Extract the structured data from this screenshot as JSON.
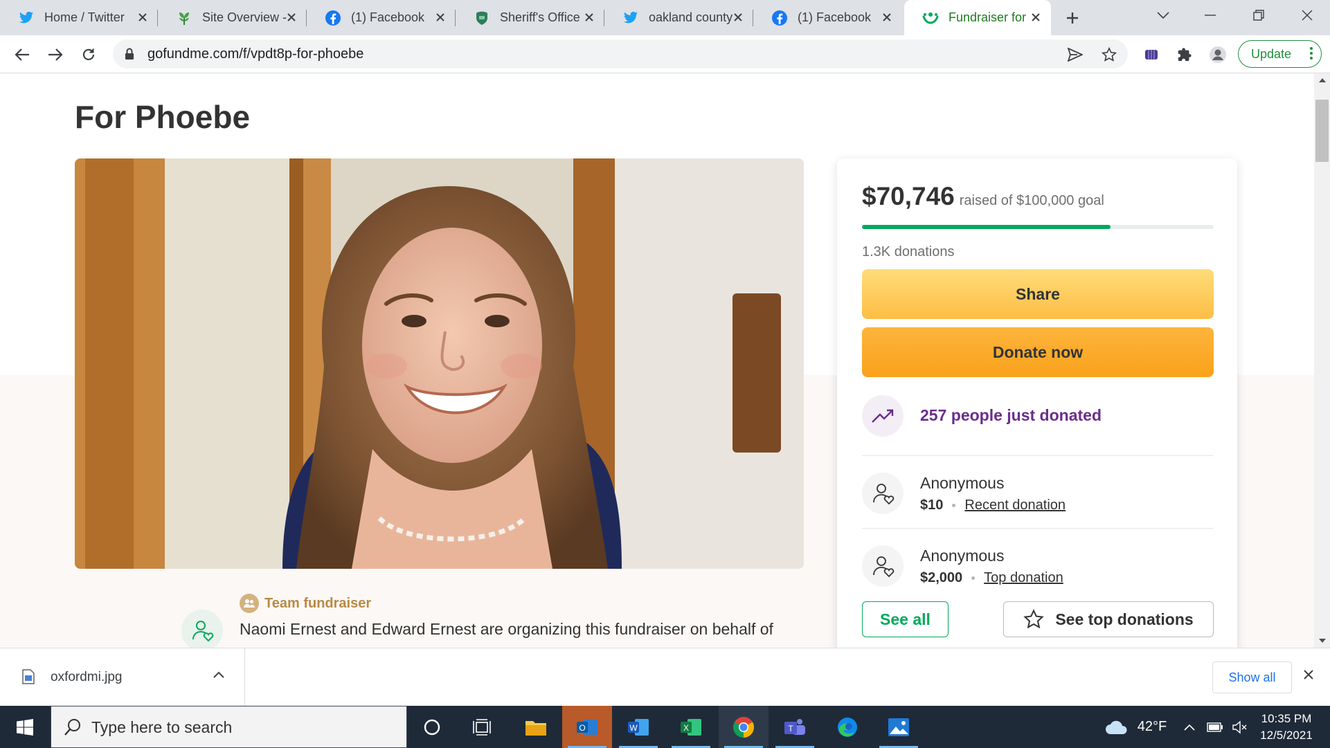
{
  "browser": {
    "tabs": [
      {
        "title": "Home / Twitter",
        "icon": "twitter-icon"
      },
      {
        "title": "Site Overview -",
        "icon": "site-leaf-icon"
      },
      {
        "title": "(1) Facebook",
        "icon": "facebook-icon"
      },
      {
        "title": "Sheriff's Office",
        "icon": "sheriff-icon"
      },
      {
        "title": "oakland county",
        "icon": "twitter-icon"
      },
      {
        "title": "(1) Facebook",
        "icon": "facebook-icon"
      },
      {
        "title": "Fundraiser for",
        "icon": "gofundme-icon"
      }
    ],
    "active_tab_index": 6,
    "url": "gofundme.com/f/vpdt8p-for-phoebe",
    "update_label": "Update"
  },
  "page": {
    "title": "For Phoebe",
    "team_label": "Team fundraiser",
    "organizer_text": "Naomi Ernest and Edward Ernest are organizing this fundraiser on behalf of"
  },
  "donation_card": {
    "raised_amount": "$70,746",
    "goal_text": "raised of $100,000 goal",
    "progress_fraction": 0.707,
    "donations_count": "1.3K donations",
    "share_label": "Share",
    "donate_label": "Donate now",
    "trend_text": "257 people just donated",
    "donors": [
      {
        "name": "Anonymous",
        "amount": "$10",
        "type": "Recent donation"
      },
      {
        "name": "Anonymous",
        "amount": "$2,000",
        "type": "Top donation"
      }
    ],
    "see_all_label": "See all",
    "see_top_label": "See top donations"
  },
  "downloads": {
    "file_name": "oxfordmi.jpg",
    "show_all_label": "Show all"
  },
  "taskbar": {
    "search_placeholder": "Type here to search",
    "weather": "42°F",
    "time": "10:35 PM",
    "date": "12/5/2021"
  },
  "colors": {
    "brand_green": "#02a95c",
    "donate_orange": "#f9a21b",
    "trend_purple": "#6b2d8d",
    "team_gold": "#b98a45"
  }
}
